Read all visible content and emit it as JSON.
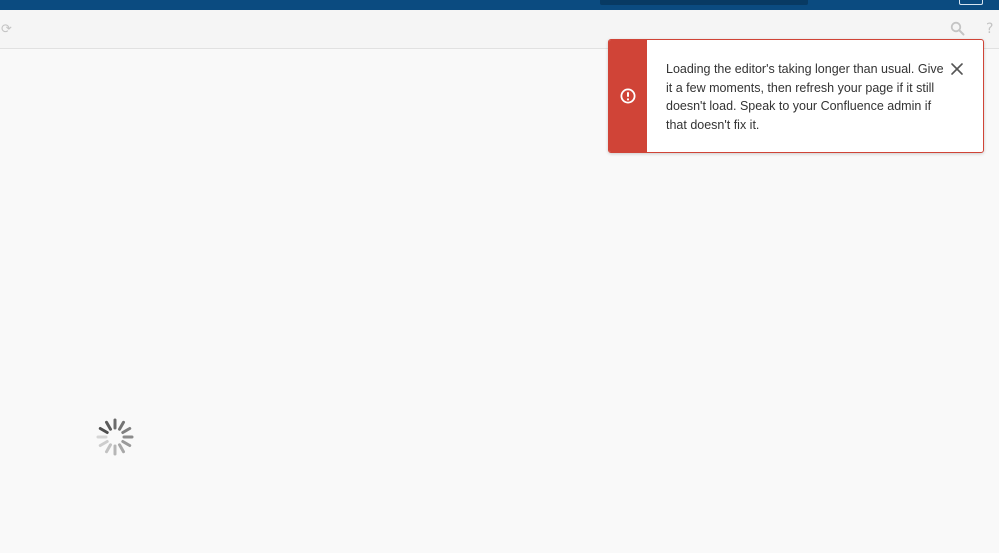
{
  "header": {
    "search_icon": "search-icon",
    "help_icon": "help-icon",
    "refresh_icon": "refresh-icon",
    "help_glyph": "?"
  },
  "flag": {
    "type": "error",
    "icon": "error-icon",
    "message": "Loading the editor's taking longer than usual. Give it a few moments, then refresh your page if it still doesn't load. Speak to your Confluence admin if that doesn't fix it.",
    "close_icon": "close-icon"
  },
  "loading": {
    "icon": "spinner-icon"
  },
  "colors": {
    "header": "#0b4b80",
    "error": "#d04437",
    "background": "#f9f9f9",
    "text": "#333333"
  }
}
